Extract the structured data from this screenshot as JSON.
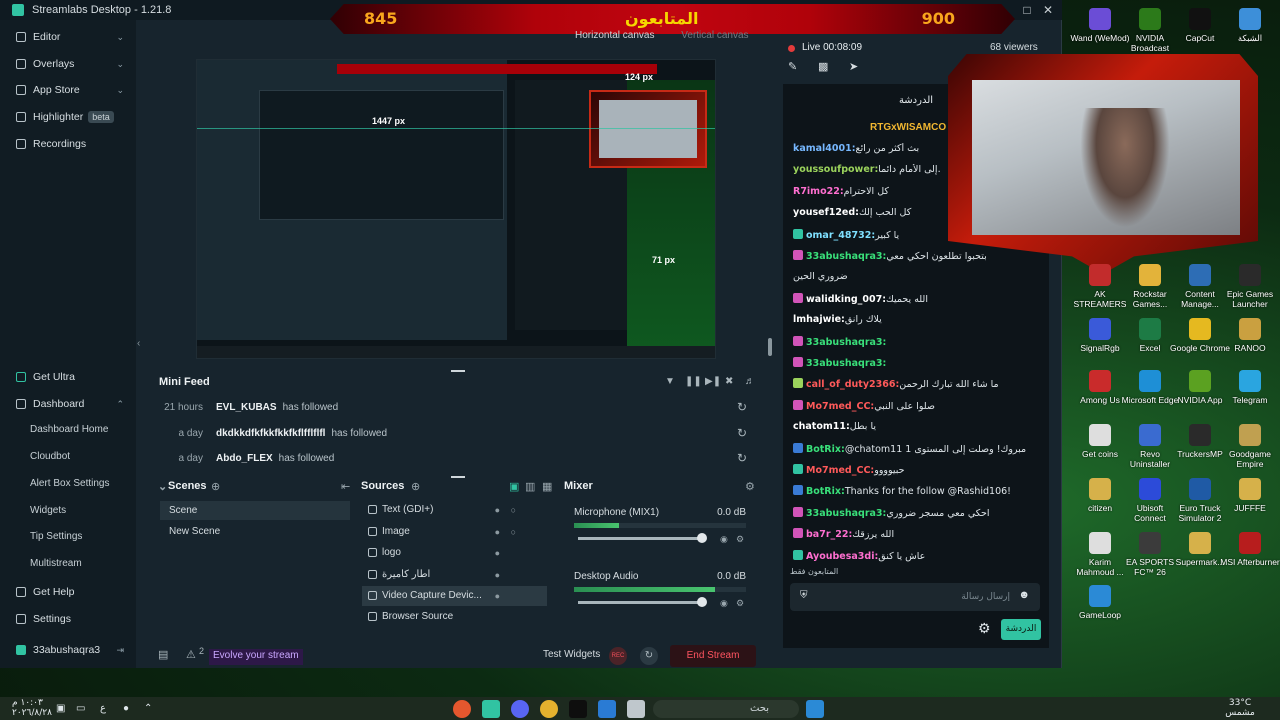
{
  "window": {
    "title": "Streamlabs Desktop - 1.21.8"
  },
  "banner": {
    "left_count": "845",
    "center_label": "المتابعون",
    "right_count": "900"
  },
  "sidebar": {
    "top_items": [
      {
        "label": "Editor"
      },
      {
        "label": "Overlays"
      },
      {
        "label": "App Store"
      },
      {
        "label": "Highlighter",
        "badge": "beta"
      },
      {
        "label": "Recordings"
      }
    ],
    "bottom_items": {
      "get_ultra": "Get Ultra",
      "dashboard": "Dashboard",
      "dashboard_sub": [
        "Dashboard Home",
        "Cloudbot",
        "Alert Box Settings",
        "Widgets",
        "Tip Settings",
        "Multistream"
      ],
      "get_help": "Get Help",
      "settings": "Settings",
      "user": "33abushaqra3"
    }
  },
  "canvas_tabs": {
    "horizontal": "Horizontal canvas",
    "vertical": "Vertical canvas"
  },
  "preview": {
    "dim_width": "1447 px",
    "dim_top": "124 px",
    "dim_right": "71 px"
  },
  "mini_feed": {
    "title": "Mini Feed",
    "rows": [
      {
        "time": "21 hours",
        "user": "EVL_KUBAS",
        "action": "has followed"
      },
      {
        "time": "a day",
        "user": "dkdkkdfkfkkfkkfkflfflflfl",
        "action": "has followed"
      },
      {
        "time": "a day",
        "user": "Abdo_FLEX",
        "action": "has followed"
      }
    ]
  },
  "scenes": {
    "title": "Scenes",
    "items": [
      "Scene",
      "New Scene"
    ],
    "selected": 0
  },
  "sources": {
    "title": "Sources",
    "items": [
      "Text (GDI+)",
      "Image",
      "logo",
      "اطار كاميرة",
      "Video Capture Devic...",
      "Browser Source"
    ],
    "selected": 4
  },
  "mixer": {
    "title": "Mixer",
    "channels": [
      {
        "name": "Microphone (MIX1)",
        "db": "0.0 dB",
        "level": 0.26
      },
      {
        "name": "Desktop Audio",
        "db": "0.0 dB",
        "level": 0.82
      }
    ]
  },
  "bottom_bar": {
    "notifications": "2",
    "evolve": "Evolve your stream",
    "test_widgets": "Test Widgets",
    "rec": "REC",
    "end_stream": "End Stream"
  },
  "live": {
    "status": "Live 00:08:09",
    "viewers": "68 viewers"
  },
  "chat": {
    "header": "الدردشة",
    "pinned": "RTGxWISAMCO",
    "messages": [
      {
        "user": "kamal4001:",
        "text": "بث أكثر من رائع",
        "color": "#77b8ff",
        "badge": ""
      },
      {
        "user": "youssoufpower:",
        "text": "إلى الأمام دائما.",
        "color": "#9bd35c",
        "badge": ""
      },
      {
        "user": "R7imo22:",
        "text": "كل الاحترام",
        "color": "#ff6fd0",
        "badge": ""
      },
      {
        "user": "yousef12ed:",
        "text": "كل الحب إلك",
        "color": "#ffffff",
        "badge": ""
      },
      {
        "user": "omar_48732:",
        "text": "يا كبير",
        "color": "#7fe0ff",
        "badge": "#31c3a2"
      },
      {
        "user": "33abushaqra3:",
        "text": "بتحبوا تطلعون احكي معي",
        "color": "#39e07a",
        "badge": "#d154b8"
      },
      {
        "user": "",
        "text": "ضروري الحين",
        "color": "#dfe6ea",
        "badge": ""
      },
      {
        "user": "walidking_007:",
        "text": "الله يحميك",
        "color": "#ffffff",
        "badge": "#d154b8"
      },
      {
        "user": "lmhajwie:",
        "text": "يلاك رانق",
        "color": "#ffffff",
        "badge": ""
      },
      {
        "user": "33abushaqra3:",
        "text": "",
        "color": "#39e07a",
        "badge": "#d154b8"
      },
      {
        "user": "33abushaqra3:",
        "text": "",
        "color": "#39e07a",
        "badge": "#d154b8"
      },
      {
        "user": "call_of_duty2366:",
        "text": "ما شاء الله تبارك الرحمن",
        "color": "#ff5a5a",
        "badge": "#9bd35c"
      },
      {
        "user": "Mo7med_CC:",
        "text": "صلوا على النبي",
        "color": "#ff5a5a",
        "badge": "#d154b8"
      },
      {
        "user": "chatom11:",
        "text": "يا بطل",
        "color": "#ffffff",
        "badge": ""
      },
      {
        "user": "BotRix:",
        "text": "@chatom11 مبروك! وصلت إلى المستوى 1",
        "color": "#39e07a",
        "badge": "#3a7bd5"
      },
      {
        "user": "Mo7med_CC:",
        "text": "حبيوووو",
        "color": "#ff5a5a",
        "badge": "#31c3a2"
      },
      {
        "user": "BotRix:",
        "text": "Thanks for the follow @Rashid106!",
        "color": "#39e07a",
        "badge": "#3a7bd5"
      },
      {
        "user": "33abushaqra3:",
        "text": "احكي معي مسجر ضروري",
        "color": "#39e07a",
        "badge": "#d154b8"
      },
      {
        "user": "ba7r_22:",
        "text": "الله يرزقك",
        "color": "#ff6fd0",
        "badge": "#d154b8"
      },
      {
        "user": "Ayoubesa3di:",
        "text": "عاش يا كنق",
        "color": "#ff6fd0",
        "badge": "#31c3a2"
      }
    ],
    "followers_only": "المتابعون فقط",
    "input_placeholder": "إرسال رسالة",
    "chat_button": "الدردشة"
  },
  "desktop_icons": [
    {
      "label": "Wand (WeMod)",
      "color": "#6b4dd6"
    },
    {
      "label": "NVIDIA Broadcast",
      "color": "#2c7a1a"
    },
    {
      "label": "CapCut",
      "color": "#111111"
    },
    {
      "label": "الشبكة",
      "color": "#3d8fd9"
    },
    {
      "label": "AK STREAMERS",
      "color": "#c22c2c"
    },
    {
      "label": "Rockstar Games...",
      "color": "#e3b33a"
    },
    {
      "label": "Content Manage...",
      "color": "#2d6db5"
    },
    {
      "label": "Epic Games Launcher",
      "color": "#2a2a2a"
    },
    {
      "label": "SignalRgb",
      "color": "#3a5ad9"
    },
    {
      "label": "Excel",
      "color": "#1d7b45"
    },
    {
      "label": "Google Chrome",
      "color": "#e5b920"
    },
    {
      "label": "RANOO",
      "color": "#caa040"
    },
    {
      "label": "Among Us",
      "color": "#c92b2b"
    },
    {
      "label": "Microsoft Edge",
      "color": "#1e8fd6"
    },
    {
      "label": "NVIDIA App",
      "color": "#5ba121"
    },
    {
      "label": "Telegram",
      "color": "#2aa5e0"
    },
    {
      "label": "Get coins",
      "color": "#dedede"
    },
    {
      "label": "Revo Uninstaller",
      "color": "#3a6bd0"
    },
    {
      "label": "TruckersMP",
      "color": "#2a2a2a"
    },
    {
      "label": "Goodgame Empire",
      "color": "#c0a050"
    },
    {
      "label": "citizen",
      "color": "#d6b14a"
    },
    {
      "label": "Ubisoft Connect",
      "color": "#2c4bd9"
    },
    {
      "label": "Euro Truck Simulator 2",
      "color": "#1f5aa5"
    },
    {
      "label": "JUFFFE",
      "color": "#d6b14a"
    },
    {
      "label": "Karim Mahmoud ...",
      "color": "#dedede"
    },
    {
      "label": "EA SPORTS FC™ 26",
      "color": "#3b3b3b"
    },
    {
      "label": "Supermark...",
      "color": "#d6b14a"
    },
    {
      "label": "MSI Afterburner",
      "color": "#b71d1d"
    },
    {
      "label": "GameLoop",
      "color": "#2b8ad6"
    }
  ],
  "taskbar": {
    "search": "بحث",
    "weather_temp": "33°C",
    "weather_text": "مشمس",
    "time": "١٠:٠٣ م",
    "date": "٢٠٢٦/٨/٢٨",
    "lang": "ع"
  }
}
